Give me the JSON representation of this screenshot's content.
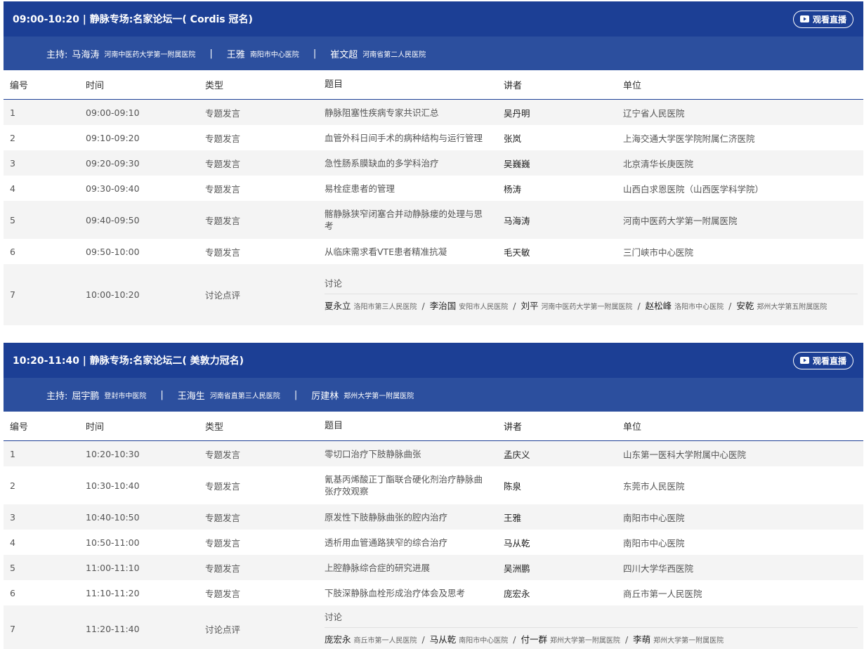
{
  "headers": [
    "编号",
    "时间",
    "类型",
    "题目",
    "讲者",
    "单位"
  ],
  "live_label": "观看直播",
  "host_label": "主持:",
  "host_sep": "|",
  "talk_sep": "/",
  "sessions": [
    {
      "title": "09:00-10:20 | 静脉专场:名家论坛一( Cordis 冠名)",
      "hosts": [
        {
          "name": "马海涛",
          "org": "河南中医药大学第一附属医院"
        },
        {
          "name": "王雅",
          "org": "南阳市中心医院"
        },
        {
          "name": "崔文超",
          "org": "河南省第二人民医院"
        }
      ],
      "rows": [
        {
          "no": "1",
          "time": "09:00-09:10",
          "type": "专题发言",
          "topic": "静脉阻塞性疾病专家共识汇总",
          "speaker": "吴丹明",
          "org": "辽宁省人民医院"
        },
        {
          "no": "2",
          "time": "09:10-09:20",
          "type": "专题发言",
          "topic": "血管外科日间手术的病种结构与运行管理",
          "speaker": "张岚",
          "org": "上海交通大学医学院附属仁济医院"
        },
        {
          "no": "3",
          "time": "09:20-09:30",
          "type": "专题发言",
          "topic": "急性肠系膜缺血的多学科治疗",
          "speaker": "吴巍巍",
          "org": "北京清华长庚医院"
        },
        {
          "no": "4",
          "time": "09:30-09:40",
          "type": "专题发言",
          "topic": "易栓症患者的管理",
          "speaker": "杨涛",
          "org": "山西白求恩医院（山西医学科学院）"
        },
        {
          "no": "5",
          "time": "09:40-09:50",
          "type": "专题发言",
          "topic": "髂静脉狭窄闭塞合并动静脉瘘的处理与思考",
          "speaker": "马海涛",
          "org": "河南中医药大学第一附属医院"
        },
        {
          "no": "6",
          "time": "09:50-10:00",
          "type": "专题发言",
          "topic": "从临床需求看VTE患者精准抗凝",
          "speaker": "毛天敏",
          "org": "三门峡市中心医院"
        }
      ],
      "discussion": {
        "no": "7",
        "time": "10:00-10:20",
        "type": "讨论点评",
        "title": "讨论",
        "people": [
          {
            "name": "夏永立",
            "org": "洛阳市第三人民医院"
          },
          {
            "name": "李治国",
            "org": "安阳市人民医院"
          },
          {
            "name": "刘平",
            "org": "河南中医药大学第一附属医院"
          },
          {
            "name": "赵松峰",
            "org": "洛阳市中心医院"
          },
          {
            "name": "安乾",
            "org": "郑州大学第五附属医院"
          }
        ]
      }
    },
    {
      "title": "10:20-11:40 | 静脉专场:名家论坛二( 美敦力冠名)",
      "hosts": [
        {
          "name": "屈宇鹏",
          "org": "登封市中医院"
        },
        {
          "name": "王海生",
          "org": "河南省直第三人民医院"
        },
        {
          "name": "厉建林",
          "org": "郑州大学第一附属医院"
        }
      ],
      "rows": [
        {
          "no": "1",
          "time": "10:20-10:30",
          "type": "专题发言",
          "topic": "零切口治疗下肢静脉曲张",
          "speaker": "孟庆义",
          "org": "山东第一医科大学附属中心医院"
        },
        {
          "no": "2",
          "time": "10:30-10:40",
          "type": "专题发言",
          "topic": "氰基丙烯酸正丁酯联合硬化剂治疗静脉曲张疗效观察",
          "speaker": "陈泉",
          "org": "东莞市人民医院"
        },
        {
          "no": "3",
          "time": "10:40-10:50",
          "type": "专题发言",
          "topic": "原发性下肢静脉曲张的腔内治疗",
          "speaker": "王雅",
          "org": "南阳市中心医院"
        },
        {
          "no": "4",
          "time": "10:50-11:00",
          "type": "专题发言",
          "topic": "透析用血管通路狭窄的综合治疗",
          "speaker": "马从乾",
          "org": "南阳市中心医院"
        },
        {
          "no": "5",
          "time": "11:00-11:10",
          "type": "专题发言",
          "topic": "上腔静脉综合症的研究进展",
          "speaker": "吴洲鹏",
          "org": "四川大学华西医院"
        },
        {
          "no": "6",
          "time": "11:10-11:20",
          "type": "专题发言",
          "topic": "下肢深静脉血栓形成治疗体会及思考",
          "speaker": "庞宏永",
          "org": "商丘市第一人民医院"
        }
      ],
      "discussion": {
        "no": "7",
        "time": "11:20-11:40",
        "type": "讨论点评",
        "title": "讨论",
        "people": [
          {
            "name": "庞宏永",
            "org": "商丘市第一人民医院"
          },
          {
            "name": "马从乾",
            "org": "南阳市中心医院"
          },
          {
            "name": "付一群",
            "org": "郑州大学第一附属医院"
          },
          {
            "name": "李萌",
            "org": "郑州大学第一附属医院"
          }
        ]
      }
    }
  ]
}
